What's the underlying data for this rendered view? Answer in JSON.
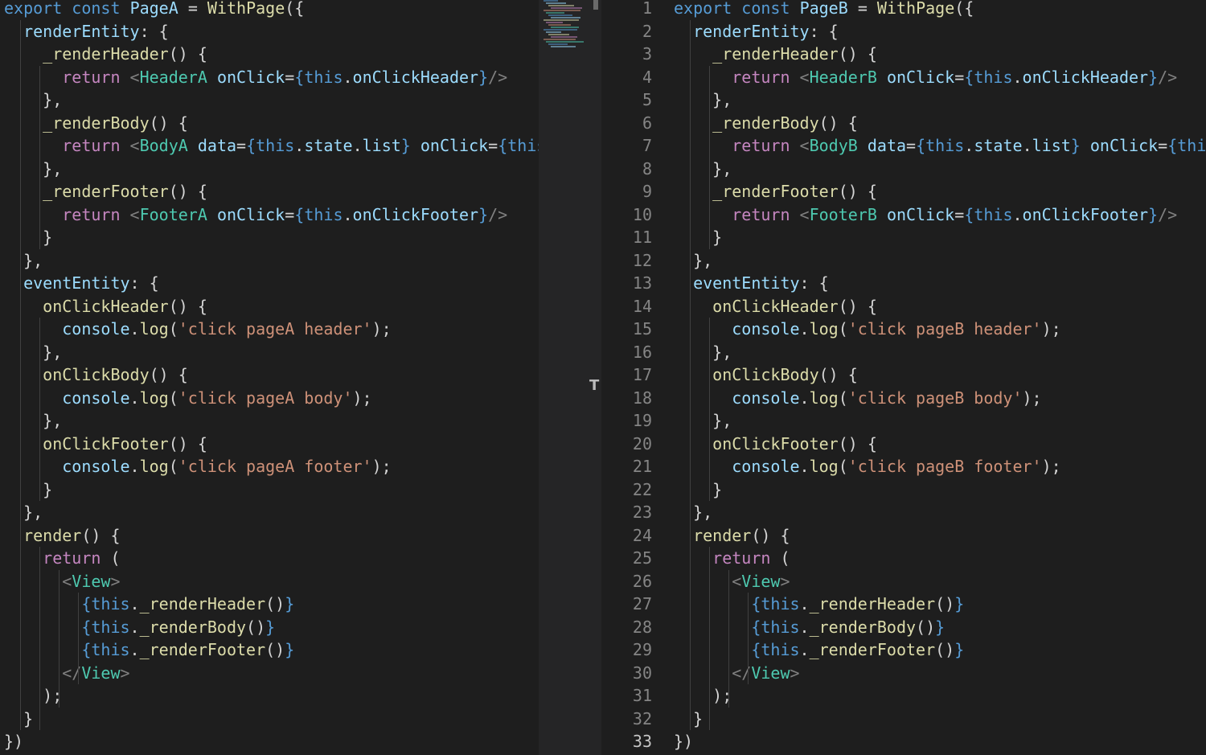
{
  "editor_left": {
    "file": "PageA",
    "lines": [
      [
        [
          "kw",
          "export"
        ],
        [
          "plain",
          " "
        ],
        [
          "kw",
          "const"
        ],
        [
          "plain",
          " "
        ],
        [
          "var",
          "PageA"
        ],
        [
          "plain",
          " = "
        ],
        [
          "fn",
          "WithPage"
        ],
        [
          "plain",
          "({"
        ]
      ],
      [
        [
          "plain",
          "  "
        ],
        [
          "var",
          "renderEntity"
        ],
        [
          "plain",
          ": {"
        ]
      ],
      [
        [
          "plain",
          "    "
        ],
        [
          "fn",
          "_renderHeader"
        ],
        [
          "plain",
          "() {"
        ]
      ],
      [
        [
          "plain",
          "      "
        ],
        [
          "ret",
          "return"
        ],
        [
          "plain",
          " "
        ],
        [
          "brk",
          "<"
        ],
        [
          "tag",
          "HeaderA"
        ],
        [
          "plain",
          " "
        ],
        [
          "var",
          "onClick"
        ],
        [
          "plain",
          "="
        ],
        [
          "kw",
          "{"
        ],
        [
          "this",
          "this"
        ],
        [
          "plain",
          "."
        ],
        [
          "var",
          "onClickHeader"
        ],
        [
          "kw",
          "}"
        ],
        [
          "brk",
          "/>"
        ]
      ],
      [
        [
          "plain",
          "    },"
        ]
      ],
      [
        [
          "plain",
          "    "
        ],
        [
          "fn",
          "_renderBody"
        ],
        [
          "plain",
          "() {"
        ]
      ],
      [
        [
          "plain",
          "      "
        ],
        [
          "ret",
          "return"
        ],
        [
          "plain",
          " "
        ],
        [
          "brk",
          "<"
        ],
        [
          "tag",
          "BodyA"
        ],
        [
          "plain",
          " "
        ],
        [
          "var",
          "data"
        ],
        [
          "plain",
          "="
        ],
        [
          "kw",
          "{"
        ],
        [
          "this",
          "this"
        ],
        [
          "plain",
          "."
        ],
        [
          "var",
          "state"
        ],
        [
          "plain",
          "."
        ],
        [
          "var",
          "list"
        ],
        [
          "kw",
          "}"
        ],
        [
          "plain",
          " "
        ],
        [
          "var",
          "onClick"
        ],
        [
          "plain",
          "="
        ],
        [
          "kw",
          "{"
        ],
        [
          "this",
          "this"
        ],
        [
          "plain",
          "."
        ],
        [
          "var",
          "onClickBody"
        ],
        [
          "kw",
          "}"
        ],
        [
          "brk",
          "/>"
        ]
      ],
      [
        [
          "plain",
          "    },"
        ]
      ],
      [
        [
          "plain",
          "    "
        ],
        [
          "fn",
          "_renderFooter"
        ],
        [
          "plain",
          "() {"
        ]
      ],
      [
        [
          "plain",
          "      "
        ],
        [
          "ret",
          "return"
        ],
        [
          "plain",
          " "
        ],
        [
          "brk",
          "<"
        ],
        [
          "tag",
          "FooterA"
        ],
        [
          "plain",
          " "
        ],
        [
          "var",
          "onClick"
        ],
        [
          "plain",
          "="
        ],
        [
          "kw",
          "{"
        ],
        [
          "this",
          "this"
        ],
        [
          "plain",
          "."
        ],
        [
          "var",
          "onClickFooter"
        ],
        [
          "kw",
          "}"
        ],
        [
          "brk",
          "/>"
        ]
      ],
      [
        [
          "plain",
          "    }"
        ]
      ],
      [
        [
          "plain",
          "  },"
        ]
      ],
      [
        [
          "plain",
          "  "
        ],
        [
          "var",
          "eventEntity"
        ],
        [
          "plain",
          ": {"
        ]
      ],
      [
        [
          "plain",
          "    "
        ],
        [
          "fn",
          "onClickHeader"
        ],
        [
          "plain",
          "() {"
        ]
      ],
      [
        [
          "plain",
          "      "
        ],
        [
          "var",
          "console"
        ],
        [
          "plain",
          "."
        ],
        [
          "fn",
          "log"
        ],
        [
          "plain",
          "("
        ],
        [
          "str",
          "'click pageA header'"
        ],
        [
          "plain",
          ");"
        ]
      ],
      [
        [
          "plain",
          "    },"
        ]
      ],
      [
        [
          "plain",
          "    "
        ],
        [
          "fn",
          "onClickBody"
        ],
        [
          "plain",
          "() {"
        ]
      ],
      [
        [
          "plain",
          "      "
        ],
        [
          "var",
          "console"
        ],
        [
          "plain",
          "."
        ],
        [
          "fn",
          "log"
        ],
        [
          "plain",
          "("
        ],
        [
          "str",
          "'click pageA body'"
        ],
        [
          "plain",
          ");"
        ]
      ],
      [
        [
          "plain",
          "    },"
        ]
      ],
      [
        [
          "plain",
          "    "
        ],
        [
          "fn",
          "onClickFooter"
        ],
        [
          "plain",
          "() {"
        ]
      ],
      [
        [
          "plain",
          "      "
        ],
        [
          "var",
          "console"
        ],
        [
          "plain",
          "."
        ],
        [
          "fn",
          "log"
        ],
        [
          "plain",
          "("
        ],
        [
          "str",
          "'click pageA footer'"
        ],
        [
          "plain",
          ");"
        ]
      ],
      [
        [
          "plain",
          "    }"
        ]
      ],
      [
        [
          "plain",
          "  },"
        ]
      ],
      [
        [
          "plain",
          "  "
        ],
        [
          "fn",
          "render"
        ],
        [
          "plain",
          "() {"
        ]
      ],
      [
        [
          "plain",
          "    "
        ],
        [
          "ret",
          "return"
        ],
        [
          "plain",
          " ("
        ]
      ],
      [
        [
          "plain",
          "      "
        ],
        [
          "brk",
          "<"
        ],
        [
          "tag",
          "View"
        ],
        [
          "brk",
          ">"
        ]
      ],
      [
        [
          "plain",
          "        "
        ],
        [
          "kw",
          "{"
        ],
        [
          "this",
          "this"
        ],
        [
          "plain",
          "."
        ],
        [
          "fn",
          "_renderHeader"
        ],
        [
          "plain",
          "()"
        ],
        [
          "kw",
          "}"
        ]
      ],
      [
        [
          "plain",
          "        "
        ],
        [
          "kw",
          "{"
        ],
        [
          "this",
          "this"
        ],
        [
          "plain",
          "."
        ],
        [
          "fn",
          "_renderBody"
        ],
        [
          "plain",
          "()"
        ],
        [
          "kw",
          "}"
        ]
      ],
      [
        [
          "plain",
          "        "
        ],
        [
          "kw",
          "{"
        ],
        [
          "this",
          "this"
        ],
        [
          "plain",
          "."
        ],
        [
          "fn",
          "_renderFooter"
        ],
        [
          "plain",
          "()"
        ],
        [
          "kw",
          "}"
        ]
      ],
      [
        [
          "plain",
          "      "
        ],
        [
          "brk",
          "</"
        ],
        [
          "tag",
          "View"
        ],
        [
          "brk",
          ">"
        ]
      ],
      [
        [
          "plain",
          "    );"
        ]
      ],
      [
        [
          "plain",
          "  }"
        ]
      ],
      [
        [
          "plain",
          "})"
        ]
      ]
    ]
  },
  "editor_right": {
    "file": "PageB",
    "line_numbers": [
      "1",
      "2",
      "3",
      "4",
      "5",
      "6",
      "7",
      "8",
      "9",
      "10",
      "11",
      "12",
      "13",
      "14",
      "15",
      "16",
      "17",
      "18",
      "19",
      "20",
      "21",
      "22",
      "23",
      "24",
      "25",
      "26",
      "27",
      "28",
      "29",
      "30",
      "31",
      "32",
      "33"
    ],
    "active_line": "33",
    "lines": [
      [
        [
          "kw",
          "export"
        ],
        [
          "plain",
          " "
        ],
        [
          "kw",
          "const"
        ],
        [
          "plain",
          " "
        ],
        [
          "var",
          "PageB"
        ],
        [
          "plain",
          " = "
        ],
        [
          "fn",
          "WithPage"
        ],
        [
          "plain",
          "({"
        ]
      ],
      [
        [
          "plain",
          "  "
        ],
        [
          "var",
          "renderEntity"
        ],
        [
          "plain",
          ": {"
        ]
      ],
      [
        [
          "plain",
          "    "
        ],
        [
          "fn",
          "_renderHeader"
        ],
        [
          "plain",
          "() {"
        ]
      ],
      [
        [
          "plain",
          "      "
        ],
        [
          "ret",
          "return"
        ],
        [
          "plain",
          " "
        ],
        [
          "brk",
          "<"
        ],
        [
          "tag",
          "HeaderB"
        ],
        [
          "plain",
          " "
        ],
        [
          "var",
          "onClick"
        ],
        [
          "plain",
          "="
        ],
        [
          "kw",
          "{"
        ],
        [
          "this",
          "this"
        ],
        [
          "plain",
          "."
        ],
        [
          "var",
          "onClickHeader"
        ],
        [
          "kw",
          "}"
        ],
        [
          "brk",
          "/>"
        ]
      ],
      [
        [
          "plain",
          "    },"
        ]
      ],
      [
        [
          "plain",
          "    "
        ],
        [
          "fn",
          "_renderBody"
        ],
        [
          "plain",
          "() {"
        ]
      ],
      [
        [
          "plain",
          "      "
        ],
        [
          "ret",
          "return"
        ],
        [
          "plain",
          " "
        ],
        [
          "brk",
          "<"
        ],
        [
          "tag",
          "BodyB"
        ],
        [
          "plain",
          " "
        ],
        [
          "var",
          "data"
        ],
        [
          "plain",
          "="
        ],
        [
          "kw",
          "{"
        ],
        [
          "this",
          "this"
        ],
        [
          "plain",
          "."
        ],
        [
          "var",
          "state"
        ],
        [
          "plain",
          "."
        ],
        [
          "var",
          "list"
        ],
        [
          "kw",
          "}"
        ],
        [
          "plain",
          " "
        ],
        [
          "var",
          "onClick"
        ],
        [
          "plain",
          "="
        ],
        [
          "kw",
          "{"
        ],
        [
          "this",
          "this"
        ],
        [
          "plain",
          "."
        ],
        [
          "var",
          "onClickBody"
        ],
        [
          "kw",
          "}"
        ],
        [
          "brk",
          "/>"
        ]
      ],
      [
        [
          "plain",
          "    },"
        ]
      ],
      [
        [
          "plain",
          "    "
        ],
        [
          "fn",
          "_renderFooter"
        ],
        [
          "plain",
          "() {"
        ]
      ],
      [
        [
          "plain",
          "      "
        ],
        [
          "ret",
          "return"
        ],
        [
          "plain",
          " "
        ],
        [
          "brk",
          "<"
        ],
        [
          "tag",
          "FooterB"
        ],
        [
          "plain",
          " "
        ],
        [
          "var",
          "onClick"
        ],
        [
          "plain",
          "="
        ],
        [
          "kw",
          "{"
        ],
        [
          "this",
          "this"
        ],
        [
          "plain",
          "."
        ],
        [
          "var",
          "onClickFooter"
        ],
        [
          "kw",
          "}"
        ],
        [
          "brk",
          "/>"
        ]
      ],
      [
        [
          "plain",
          "    }"
        ]
      ],
      [
        [
          "plain",
          "  },"
        ]
      ],
      [
        [
          "plain",
          "  "
        ],
        [
          "var",
          "eventEntity"
        ],
        [
          "plain",
          ": {"
        ]
      ],
      [
        [
          "plain",
          "    "
        ],
        [
          "fn",
          "onClickHeader"
        ],
        [
          "plain",
          "() {"
        ]
      ],
      [
        [
          "plain",
          "      "
        ],
        [
          "var",
          "console"
        ],
        [
          "plain",
          "."
        ],
        [
          "fn",
          "log"
        ],
        [
          "plain",
          "("
        ],
        [
          "str",
          "'click pageB header'"
        ],
        [
          "plain",
          ");"
        ]
      ],
      [
        [
          "plain",
          "    },"
        ]
      ],
      [
        [
          "plain",
          "    "
        ],
        [
          "fn",
          "onClickBody"
        ],
        [
          "plain",
          "() {"
        ]
      ],
      [
        [
          "plain",
          "      "
        ],
        [
          "var",
          "console"
        ],
        [
          "plain",
          "."
        ],
        [
          "fn",
          "log"
        ],
        [
          "plain",
          "("
        ],
        [
          "str",
          "'click pageB body'"
        ],
        [
          "plain",
          ");"
        ]
      ],
      [
        [
          "plain",
          "    },"
        ]
      ],
      [
        [
          "plain",
          "    "
        ],
        [
          "fn",
          "onClickFooter"
        ],
        [
          "plain",
          "() {"
        ]
      ],
      [
        [
          "plain",
          "      "
        ],
        [
          "var",
          "console"
        ],
        [
          "plain",
          "."
        ],
        [
          "fn",
          "log"
        ],
        [
          "plain",
          "("
        ],
        [
          "str",
          "'click pageB footer'"
        ],
        [
          "plain",
          ");"
        ]
      ],
      [
        [
          "plain",
          "    }"
        ]
      ],
      [
        [
          "plain",
          "  },"
        ]
      ],
      [
        [
          "plain",
          "  "
        ],
        [
          "fn",
          "render"
        ],
        [
          "plain",
          "() {"
        ]
      ],
      [
        [
          "plain",
          "    "
        ],
        [
          "ret",
          "return"
        ],
        [
          "plain",
          " ("
        ]
      ],
      [
        [
          "plain",
          "      "
        ],
        [
          "brk",
          "<"
        ],
        [
          "tag",
          "View"
        ],
        [
          "brk",
          ">"
        ]
      ],
      [
        [
          "plain",
          "        "
        ],
        [
          "kw",
          "{"
        ],
        [
          "this",
          "this"
        ],
        [
          "plain",
          "."
        ],
        [
          "fn",
          "_renderHeader"
        ],
        [
          "plain",
          "()"
        ],
        [
          "kw",
          "}"
        ]
      ],
      [
        [
          "plain",
          "        "
        ],
        [
          "kw",
          "{"
        ],
        [
          "this",
          "this"
        ],
        [
          "plain",
          "."
        ],
        [
          "fn",
          "_renderBody"
        ],
        [
          "plain",
          "()"
        ],
        [
          "kw",
          "}"
        ]
      ],
      [
        [
          "plain",
          "        "
        ],
        [
          "kw",
          "{"
        ],
        [
          "this",
          "this"
        ],
        [
          "plain",
          "."
        ],
        [
          "fn",
          "_renderFooter"
        ],
        [
          "plain",
          "()"
        ],
        [
          "kw",
          "}"
        ]
      ],
      [
        [
          "plain",
          "      "
        ],
        [
          "brk",
          "</"
        ],
        [
          "tag",
          "View"
        ],
        [
          "brk",
          ">"
        ]
      ],
      [
        [
          "plain",
          "    );"
        ]
      ],
      [
        [
          "plain",
          "  }"
        ]
      ],
      [
        [
          "plain",
          "})"
        ]
      ]
    ]
  },
  "split_handle_glyph": "T",
  "colors": {
    "background": "#1e1e1e",
    "keyword": "#569cd6",
    "variable": "#9cdcfe",
    "function": "#dcdcaa",
    "string": "#ce9178",
    "tag": "#4ec9b0",
    "control": "#c586c0"
  }
}
